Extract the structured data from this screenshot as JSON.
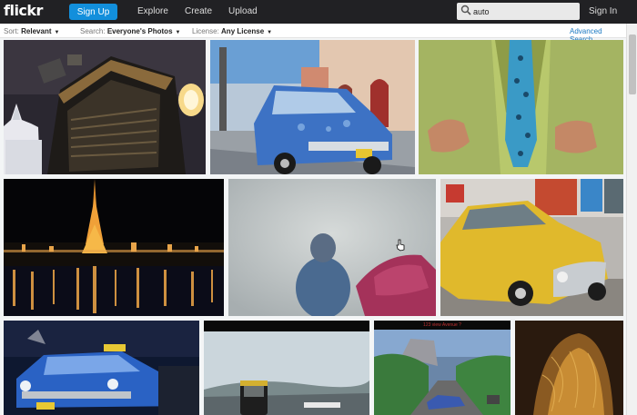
{
  "header": {
    "logo": "flickr",
    "signup_label": "Sign Up",
    "nav": [
      "Explore",
      "Create",
      "Upload"
    ],
    "search_value": "auto",
    "signin_label": "Sign In"
  },
  "filters": {
    "sort_label": "Sort:",
    "sort_value": "Relevant",
    "search_label": "Search:",
    "search_value": "Everyone's Photos",
    "license_label": "License:",
    "license_value": "Any License",
    "advanced_label": "Advanced Search"
  },
  "photo_caption_text": "123 view Avenue ?",
  "colors": {
    "topbar": "#212124",
    "signup": "#128fdc",
    "link": "#1a78c2"
  }
}
